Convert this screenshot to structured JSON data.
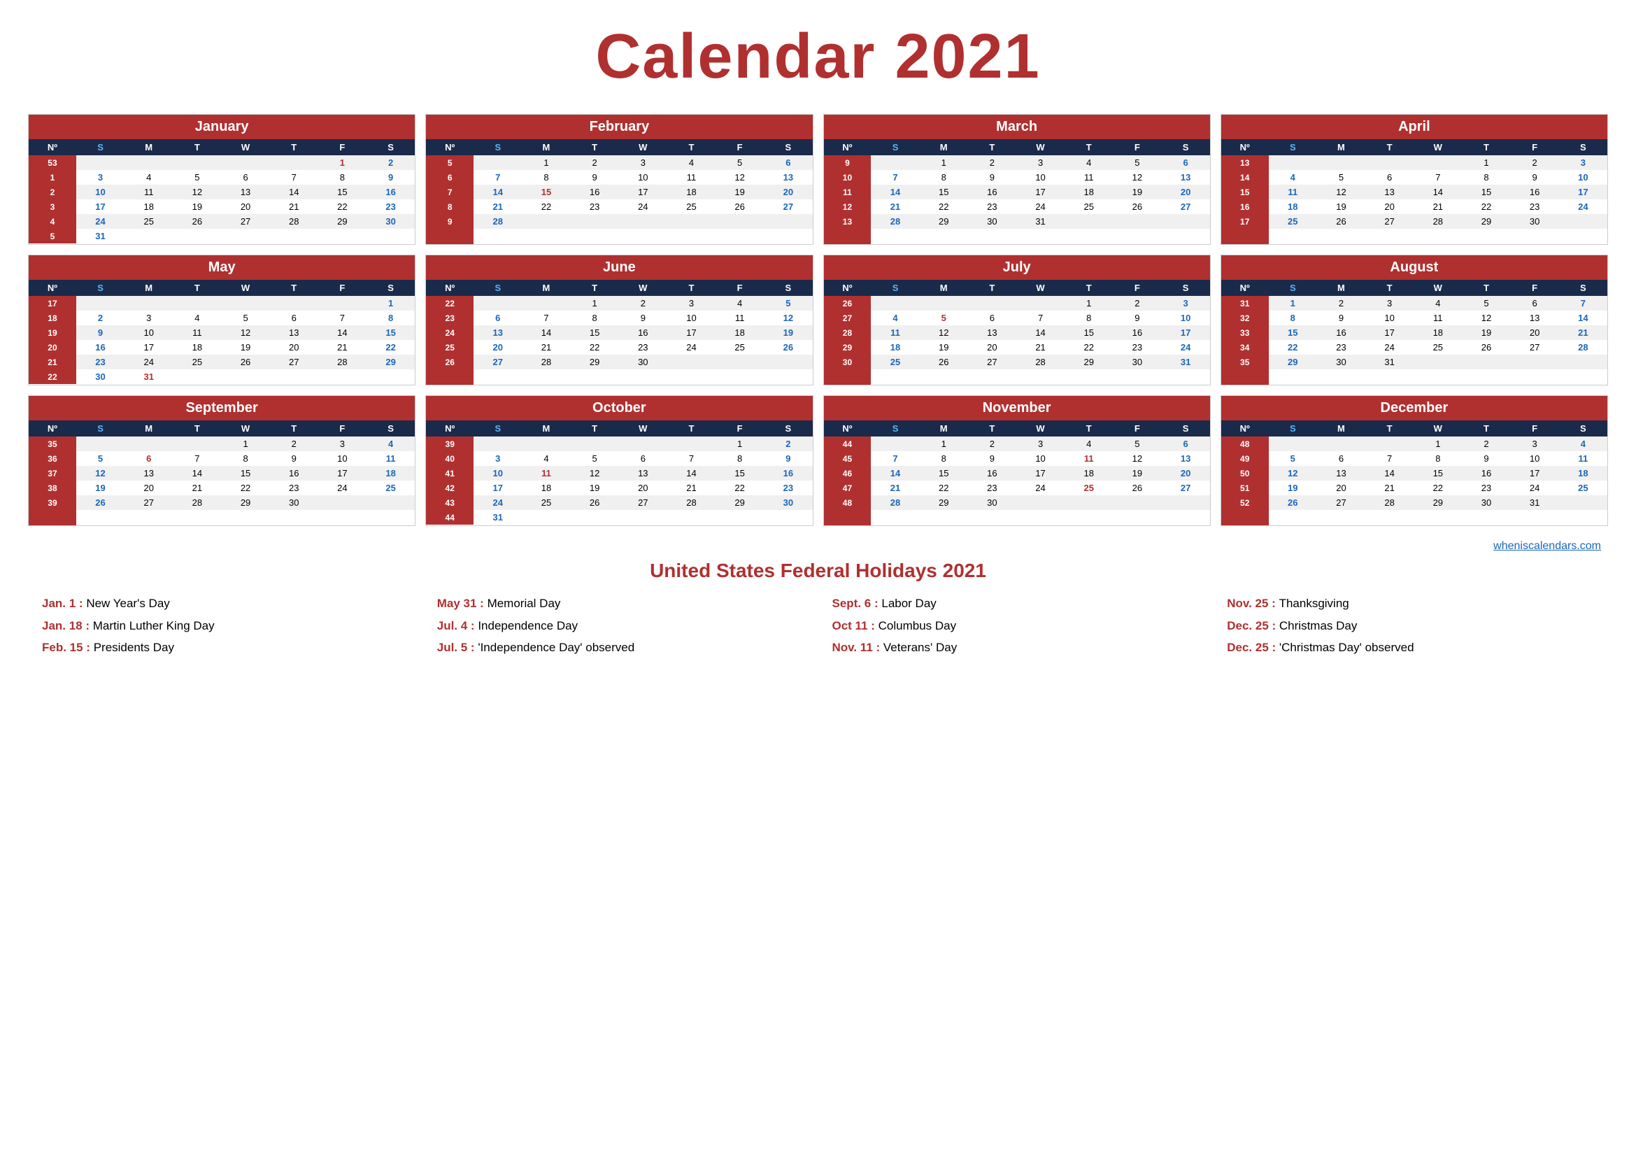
{
  "title": "Calendar 2021",
  "website": "wheniscalendars.com",
  "months": [
    {
      "name": "January",
      "headers": [
        "Nº",
        "S",
        "M",
        "T",
        "W",
        "T",
        "F",
        "S"
      ],
      "rows": [
        [
          "53",
          "",
          "",
          "",
          "",
          "",
          "1",
          "2"
        ],
        [
          "1",
          "3",
          "4",
          "5",
          "6",
          "7",
          "8",
          "9"
        ],
        [
          "2",
          "10",
          "11",
          "12",
          "13",
          "14",
          "15",
          "16"
        ],
        [
          "3",
          "17",
          "18",
          "19",
          "20",
          "21",
          "22",
          "23"
        ],
        [
          "4",
          "24",
          "25",
          "26",
          "27",
          "28",
          "29",
          "30"
        ],
        [
          "5",
          "31",
          "",
          "",
          "",
          "",
          "",
          ""
        ]
      ],
      "sundays": [
        2,
        3,
        10,
        17,
        24,
        31
      ],
      "holidays": [
        1
      ]
    },
    {
      "name": "February",
      "headers": [
        "Nº",
        "S",
        "M",
        "T",
        "W",
        "T",
        "F",
        "S"
      ],
      "rows": [
        [
          "5",
          "",
          "1",
          "2",
          "3",
          "4",
          "5",
          "6"
        ],
        [
          "6",
          "7",
          "8",
          "9",
          "10",
          "11",
          "12",
          "13"
        ],
        [
          "7",
          "14",
          "15",
          "16",
          "17",
          "18",
          "19",
          "20"
        ],
        [
          "8",
          "21",
          "22",
          "23",
          "24",
          "25",
          "26",
          "27"
        ],
        [
          "9",
          "28",
          "",
          "",
          "",
          "",
          "",
          ""
        ],
        [
          "",
          "",
          "",
          "",
          "",
          "",
          "",
          ""
        ]
      ],
      "sundays": [
        6,
        13,
        20,
        27
      ],
      "holidays": [
        15
      ]
    },
    {
      "name": "March",
      "headers": [
        "Nº",
        "S",
        "M",
        "T",
        "W",
        "T",
        "F",
        "S"
      ],
      "rows": [
        [
          "9",
          "",
          "1",
          "2",
          "3",
          "4",
          "5",
          "6"
        ],
        [
          "10",
          "7",
          "8",
          "9",
          "10",
          "11",
          "12",
          "13"
        ],
        [
          "11",
          "14",
          "15",
          "16",
          "17",
          "18",
          "19",
          "20"
        ],
        [
          "12",
          "21",
          "22",
          "23",
          "24",
          "25",
          "26",
          "27"
        ],
        [
          "13",
          "28",
          "29",
          "30",
          "31",
          "",
          "",
          ""
        ],
        [
          "",
          "",
          "",
          "",
          "",
          "",
          "",
          ""
        ]
      ],
      "sundays": [
        6,
        13,
        20,
        27
      ],
      "holidays": []
    },
    {
      "name": "April",
      "headers": [
        "Nº",
        "S",
        "M",
        "T",
        "W",
        "T",
        "F",
        "S"
      ],
      "rows": [
        [
          "13",
          "",
          "",
          "",
          "",
          "1",
          "2",
          "3"
        ],
        [
          "14",
          "4",
          "5",
          "6",
          "7",
          "8",
          "9",
          "10"
        ],
        [
          "15",
          "11",
          "12",
          "13",
          "14",
          "15",
          "16",
          "17"
        ],
        [
          "16",
          "18",
          "19",
          "20",
          "21",
          "22",
          "23",
          "24"
        ],
        [
          "17",
          "25",
          "26",
          "27",
          "28",
          "29",
          "30",
          ""
        ],
        [
          "",
          "",
          "",
          "",
          "",
          "",
          "",
          ""
        ]
      ],
      "sundays": [
        3,
        10,
        17,
        24
      ],
      "holidays": []
    },
    {
      "name": "May",
      "headers": [
        "Nº",
        "S",
        "M",
        "T",
        "W",
        "T",
        "F",
        "S"
      ],
      "rows": [
        [
          "17",
          "",
          "",
          "",
          "",
          "",
          "",
          "1"
        ],
        [
          "18",
          "2",
          "3",
          "4",
          "5",
          "6",
          "7",
          "8"
        ],
        [
          "19",
          "9",
          "10",
          "11",
          "12",
          "13",
          "14",
          "15"
        ],
        [
          "20",
          "16",
          "17",
          "18",
          "19",
          "20",
          "21",
          "22"
        ],
        [
          "21",
          "23",
          "24",
          "25",
          "26",
          "27",
          "28",
          "29"
        ],
        [
          "22",
          "30",
          "31",
          "",
          "",
          "",
          "",
          ""
        ]
      ],
      "sundays": [
        1,
        8,
        15,
        22,
        29
      ],
      "holidays": [
        31
      ]
    },
    {
      "name": "June",
      "headers": [
        "Nº",
        "S",
        "M",
        "T",
        "W",
        "T",
        "F",
        "S"
      ],
      "rows": [
        [
          "22",
          "",
          "",
          "1",
          "2",
          "3",
          "4",
          "5"
        ],
        [
          "23",
          "6",
          "7",
          "8",
          "9",
          "10",
          "11",
          "12"
        ],
        [
          "24",
          "13",
          "14",
          "15",
          "16",
          "17",
          "18",
          "19"
        ],
        [
          "25",
          "20",
          "21",
          "22",
          "23",
          "24",
          "25",
          "26"
        ],
        [
          "26",
          "27",
          "28",
          "29",
          "30",
          "",
          "",
          ""
        ],
        [
          "",
          "",
          "",
          "",
          "",
          "",
          "",
          ""
        ]
      ],
      "sundays": [
        5,
        12,
        19,
        26
      ],
      "holidays": []
    },
    {
      "name": "July",
      "headers": [
        "Nº",
        "S",
        "M",
        "T",
        "W",
        "T",
        "F",
        "S"
      ],
      "rows": [
        [
          "26",
          "",
          "",
          "",
          "",
          "1",
          "2",
          "3"
        ],
        [
          "27",
          "4",
          "5",
          "6",
          "7",
          "8",
          "9",
          "10"
        ],
        [
          "28",
          "11",
          "12",
          "13",
          "14",
          "15",
          "16",
          "17"
        ],
        [
          "29",
          "18",
          "19",
          "20",
          "21",
          "22",
          "23",
          "24"
        ],
        [
          "30",
          "25",
          "26",
          "27",
          "28",
          "29",
          "30",
          "31"
        ],
        [
          "",
          "",
          "",
          "",
          "",
          "",
          "",
          ""
        ]
      ],
      "sundays": [
        3,
        10,
        17,
        24,
        31
      ],
      "holidays": [
        4,
        5
      ]
    },
    {
      "name": "August",
      "headers": [
        "Nº",
        "S",
        "M",
        "T",
        "W",
        "T",
        "F",
        "S"
      ],
      "rows": [
        [
          "31",
          "1",
          "2",
          "3",
          "4",
          "5",
          "6",
          "7"
        ],
        [
          "32",
          "8",
          "9",
          "10",
          "11",
          "12",
          "13",
          "14"
        ],
        [
          "33",
          "15",
          "16",
          "17",
          "18",
          "19",
          "20",
          "21"
        ],
        [
          "34",
          "22",
          "23",
          "24",
          "25",
          "26",
          "27",
          "28"
        ],
        [
          "35",
          "29",
          "30",
          "31",
          "",
          "",
          "",
          ""
        ],
        [
          "",
          "",
          "",
          "",
          "",
          "",
          "",
          ""
        ]
      ],
      "sundays": [
        7,
        14,
        21,
        28
      ],
      "holidays": []
    },
    {
      "name": "September",
      "headers": [
        "Nº",
        "S",
        "M",
        "T",
        "W",
        "T",
        "F",
        "S"
      ],
      "rows": [
        [
          "35",
          "",
          "",
          "",
          "1",
          "2",
          "3",
          "4"
        ],
        [
          "36",
          "5",
          "6",
          "7",
          "8",
          "9",
          "10",
          "11"
        ],
        [
          "37",
          "12",
          "13",
          "14",
          "15",
          "16",
          "17",
          "18"
        ],
        [
          "38",
          "19",
          "20",
          "21",
          "22",
          "23",
          "24",
          "25"
        ],
        [
          "39",
          "26",
          "27",
          "28",
          "29",
          "30",
          "",
          ""
        ],
        [
          "",
          "",
          "",
          "",
          "",
          "",
          "",
          ""
        ]
      ],
      "sundays": [
        4,
        11,
        18,
        25
      ],
      "holidays": [
        6
      ]
    },
    {
      "name": "October",
      "headers": [
        "Nº",
        "S",
        "M",
        "T",
        "W",
        "T",
        "F",
        "S"
      ],
      "rows": [
        [
          "39",
          "",
          "",
          "",
          "",
          "",
          "1",
          "2"
        ],
        [
          "40",
          "3",
          "4",
          "5",
          "6",
          "7",
          "8",
          "9"
        ],
        [
          "41",
          "10",
          "11",
          "12",
          "13",
          "14",
          "15",
          "16"
        ],
        [
          "42",
          "17",
          "18",
          "19",
          "20",
          "21",
          "22",
          "23"
        ],
        [
          "43",
          "24",
          "25",
          "26",
          "27",
          "28",
          "29",
          "30"
        ],
        [
          "44",
          "31",
          "",
          "",
          "",
          "",
          "",
          ""
        ]
      ],
      "sundays": [
        2,
        9,
        16,
        23,
        30
      ],
      "holidays": [
        11
      ]
    },
    {
      "name": "November",
      "headers": [
        "Nº",
        "S",
        "M",
        "T",
        "W",
        "T",
        "F",
        "S"
      ],
      "rows": [
        [
          "44",
          "",
          "1",
          "2",
          "3",
          "4",
          "5",
          "6"
        ],
        [
          "45",
          "7",
          "8",
          "9",
          "10",
          "11",
          "12",
          "13"
        ],
        [
          "46",
          "14",
          "15",
          "16",
          "17",
          "18",
          "19",
          "20"
        ],
        [
          "47",
          "21",
          "22",
          "23",
          "24",
          "25",
          "26",
          "27"
        ],
        [
          "48",
          "28",
          "29",
          "30",
          "",
          "",
          "",
          ""
        ],
        [
          "",
          "",
          "",
          "",
          "",
          "",
          "",
          ""
        ]
      ],
      "sundays": [
        6,
        13,
        20,
        27
      ],
      "holidays": [
        11,
        25
      ]
    },
    {
      "name": "December",
      "headers": [
        "Nº",
        "S",
        "M",
        "T",
        "W",
        "T",
        "F",
        "S"
      ],
      "rows": [
        [
          "48",
          "",
          "",
          "",
          "1",
          "2",
          "3",
          "4"
        ],
        [
          "49",
          "5",
          "6",
          "7",
          "8",
          "9",
          "10",
          "11"
        ],
        [
          "50",
          "12",
          "13",
          "14",
          "15",
          "16",
          "17",
          "18"
        ],
        [
          "51",
          "19",
          "20",
          "21",
          "22",
          "23",
          "24",
          "25"
        ],
        [
          "52",
          "26",
          "27",
          "28",
          "29",
          "30",
          "31",
          ""
        ],
        [
          "",
          "",
          "",
          "",
          "",
          "",
          "",
          ""
        ]
      ],
      "sundays": [
        4,
        11,
        18,
        25
      ],
      "holidays": [
        25
      ]
    }
  ],
  "holidays_title": "United States Federal Holidays 2021",
  "holidays": [
    [
      "Jan. 1 : New Year's Day",
      "May 31 : Memorial Day",
      "Sept. 6 : Labor Day",
      "Nov. 25 : Thanksgiving"
    ],
    [
      "Jan. 18 : Martin Luther King Day",
      "Jul. 4 : Independence Day",
      "Oct 11 : Columbus Day",
      "Dec. 25 : Christmas Day"
    ],
    [
      "Feb. 15 : Presidents Day",
      "Jul. 5 : 'Independence Day' observed",
      "Nov. 11 : Veterans' Day",
      "Dec. 25 : 'Christmas Day' observed"
    ]
  ]
}
